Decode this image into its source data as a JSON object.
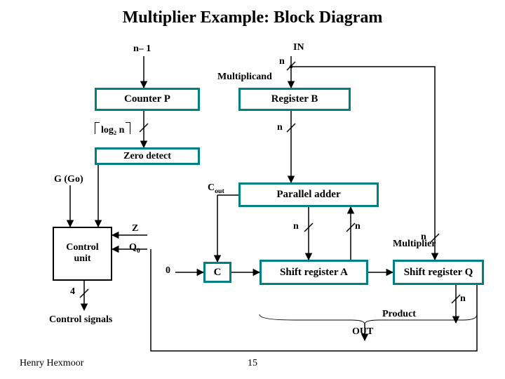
{
  "title": "Multiplier Example: Block Diagram",
  "top": {
    "n_minus_1": "n– 1",
    "in": "IN",
    "n": "n",
    "multiplicand": "Multiplicand"
  },
  "blocks": {
    "counter": "Counter P",
    "register_b": "Register B",
    "zero_detect": "Zero detect",
    "g_go": "G (Go)",
    "control_unit": "Control\nunit",
    "parallel_adder": "Parallel adder",
    "shift_a": "Shift register A",
    "shift_q": "Shift register Q"
  },
  "wires": {
    "log2n": "log₂ n",
    "n": "n",
    "cout": "C",
    "cout_sub": "out",
    "Z": "Z",
    "Q0": "Q",
    "zero": "0",
    "C_block": "C",
    "four": "4",
    "multiplier": "Multiplier",
    "control_signals": "Control signals",
    "product": "Product",
    "out": "OUT"
  },
  "footer": {
    "author": "Henry Hexmoor",
    "page": "15"
  }
}
